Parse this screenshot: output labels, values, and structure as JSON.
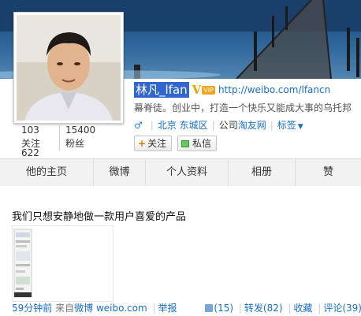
{
  "profile": {
    "name": "林凡_lfan",
    "verified_mark": "V",
    "vip_badge": "VIP",
    "url": "http://weibo.com/lfancn",
    "bio": "幕脊徒。创业中，打造一个快乐又能成大事的乌托邦",
    "gender_symbol": "♂",
    "location": "北京 东城区",
    "company_prefix": "公司",
    "company": "淘友网",
    "tags_label": "标签",
    "follow_btn": "关注",
    "message_btn": "私信"
  },
  "stats": {
    "following_count": "103",
    "following_label": "关注",
    "followers_count": "15400",
    "followers_label": "粉丝",
    "posts_count": "622"
  },
  "tabs": [
    {
      "label": "他的主页"
    },
    {
      "label": "微博"
    },
    {
      "label": "个人资料"
    },
    {
      "label": "相册"
    },
    {
      "label": "赞"
    }
  ],
  "post": {
    "text": "我们只想安静地做一款用户喜爱的产品",
    "time": "59分钟前",
    "source_prefix": "来自",
    "source": "微博 weibo.com",
    "report": "举报",
    "likes": "(15)",
    "repost": "转发(82)",
    "favorite": "收藏",
    "comment": "评论(39)"
  },
  "colors": {
    "link": "#1a6ec4",
    "name_highlight": "#3366cc",
    "tab_bg": "#f2f2f2"
  }
}
